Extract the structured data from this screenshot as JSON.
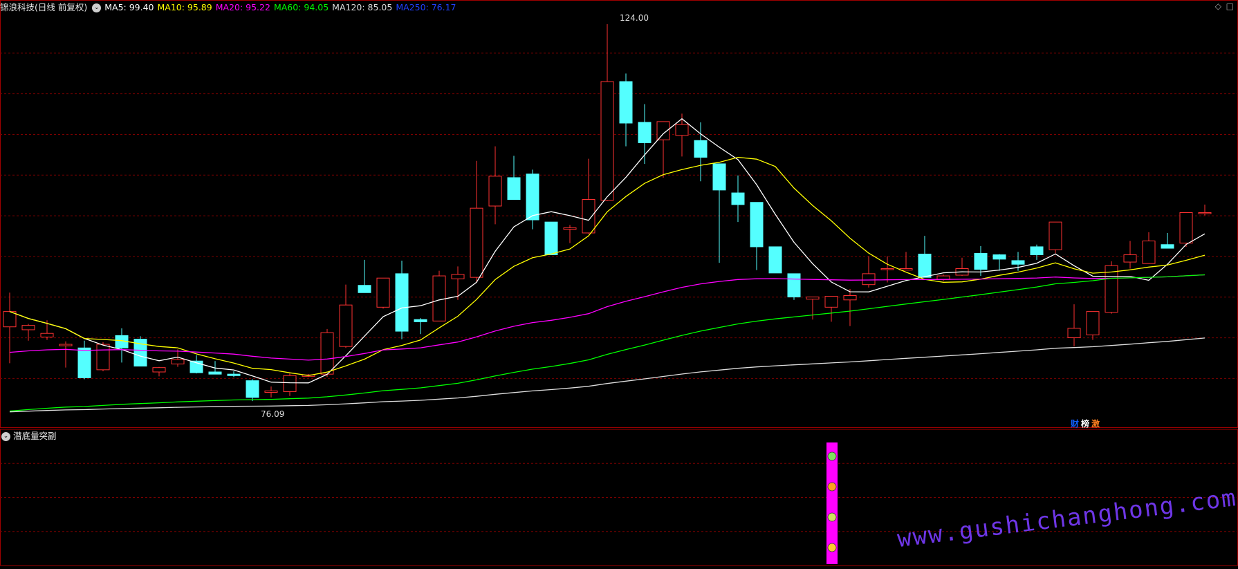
{
  "header": {
    "title": "锦浪科技(日线 前复权)",
    "ma": [
      {
        "label": "MA5: 99.40",
        "color": "#ffffff"
      },
      {
        "label": "MA10: 95.89",
        "color": "#ffff00"
      },
      {
        "label": "MA20: 95.22",
        "color": "#ff00ff"
      },
      {
        "label": "MA60: 94.05",
        "color": "#00ff00"
      },
      {
        "label": "MA120: 85.05",
        "color": "#dddddd"
      },
      {
        "label": "MA250: 76.17",
        "color": "#2040ff"
      }
    ]
  },
  "subpanel": {
    "title": "潜底量突副"
  },
  "annotations": {
    "high": "124.00",
    "low": "76.09",
    "tags": [
      "财",
      "榜",
      "激"
    ]
  },
  "watermark": "www.gushichanghong.com",
  "colors": {
    "up": "#ff3232",
    "down": "#54ffff",
    "grid": "#7a0000",
    "bg": "#000000",
    "signal": "#ff00ff"
  },
  "chart_data": {
    "type": "candlestick",
    "title": "锦浪科技(日线 前复权)",
    "ylim": [
      72,
      129
    ],
    "candles": [
      [
        85.8,
        90.5,
        80.8,
        87.9
      ],
      [
        85.4,
        86.2,
        83.9,
        86.0
      ],
      [
        84.4,
        86.7,
        84.0,
        84.9
      ],
      [
        83.2,
        83.8,
        80.2,
        83.4
      ],
      [
        82.9,
        83.9,
        78.6,
        78.8
      ],
      [
        79.9,
        83.7,
        79.7,
        83.4
      ],
      [
        84.6,
        85.6,
        80.9,
        82.9
      ],
      [
        84.1,
        84.5,
        80.6,
        80.4
      ],
      [
        79.6,
        80.3,
        79.0,
        80.2
      ],
      [
        80.7,
        82.7,
        80.3,
        81.3
      ],
      [
        81.1,
        81.9,
        79.4,
        79.5
      ],
      [
        79.6,
        81.1,
        79.4,
        79.3
      ],
      [
        79.3,
        79.7,
        78.9,
        79.1
      ],
      [
        78.4,
        78.6,
        75.6,
        76.1
      ],
      [
        76.8,
        77.6,
        76.1,
        77.0
      ],
      [
        76.9,
        79.4,
        76.3,
        79.1
      ],
      [
        79.0,
        79.3,
        78.9,
        79.2
      ],
      [
        79.3,
        85.5,
        78.9,
        85.0
      ],
      [
        83.1,
        91.6,
        82.9,
        88.8
      ],
      [
        91.5,
        95.0,
        91.1,
        90.5
      ],
      [
        88.5,
        91.9,
        88.3,
        92.5
      ],
      [
        93.1,
        94.9,
        84.1,
        85.2
      ],
      [
        86.8,
        87.0,
        84.8,
        86.5
      ],
      [
        86.6,
        93.5,
        86.6,
        92.8
      ],
      [
        92.4,
        94.1,
        89.5,
        93.0
      ],
      [
        92.6,
        108.6,
        92.0,
        102.1
      ],
      [
        102.4,
        110.6,
        99.9,
        106.5
      ],
      [
        106.3,
        109.3,
        104.2,
        103.3
      ],
      [
        106.8,
        107.4,
        99.2,
        100.5
      ],
      [
        100.2,
        99.8,
        96.7,
        95.7
      ],
      [
        99.2,
        99.8,
        97.3,
        99.4
      ],
      [
        98.7,
        108.9,
        98.6,
        103.3
      ],
      [
        103.2,
        127.4,
        103.1,
        119.5
      ],
      [
        119.5,
        120.6,
        110.6,
        113.8
      ],
      [
        113.9,
        116.4,
        108.2,
        111.1
      ],
      [
        111.5,
        113.3,
        106.3,
        114.0
      ],
      [
        112.1,
        115.1,
        109.2,
        113.6
      ],
      [
        111.4,
        113.9,
        105.8,
        109.1
      ],
      [
        108.2,
        104.8,
        94.6,
        104.6
      ],
      [
        104.2,
        106.6,
        100.2,
        102.6
      ],
      [
        102.9,
        99.5,
        93.6,
        96.8
      ],
      [
        96.8,
        96.3,
        93.6,
        93.2
      ],
      [
        93.1,
        89.7,
        89.5,
        89.9
      ],
      [
        89.6,
        87.9,
        86.8,
        89.9
      ],
      [
        88.5,
        88.8,
        86.5,
        90.0
      ],
      [
        89.5,
        91.0,
        85.9,
        90.1
      ],
      [
        91.6,
        95.5,
        91.2,
        93.1
      ],
      [
        93.8,
        95.5,
        91.9,
        93.8
      ],
      [
        93.6,
        96.1,
        93.6,
        93.8
      ],
      [
        95.8,
        98.3,
        93.6,
        92.6
      ],
      [
        92.3,
        93.0,
        92.1,
        92.8
      ],
      [
        92.9,
        95.3,
        92.8,
        93.8
      ],
      [
        95.9,
        96.9,
        92.8,
        93.7
      ],
      [
        95.7,
        95.8,
        93.5,
        95.1
      ],
      [
        94.9,
        96.1,
        93.5,
        94.4
      ],
      [
        96.8,
        97.1,
        95.0,
        95.7
      ],
      [
        96.4,
        100.1,
        95.9,
        100.2
      ],
      [
        84.3,
        88.9,
        83.1,
        85.6
      ],
      [
        84.7,
        87.0,
        84.0,
        87.9
      ],
      [
        87.8,
        94.8,
        87.6,
        94.2
      ],
      [
        94.7,
        97.6,
        93.8,
        95.7
      ],
      [
        94.5,
        98.8,
        94.5,
        97.6
      ],
      [
        97.1,
        98.7,
        96.8,
        96.6
      ],
      [
        97.3,
        100.2,
        96.8,
        101.5
      ],
      [
        101.5,
        102.6,
        101.1,
        101.5
      ]
    ]
  }
}
